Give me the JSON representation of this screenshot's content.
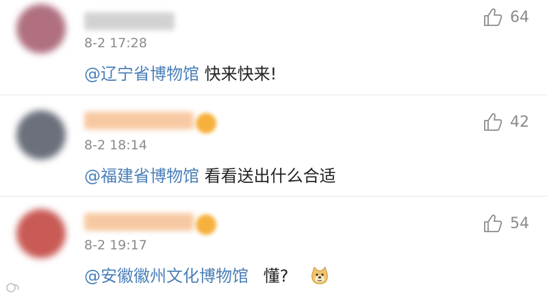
{
  "comments": [
    {
      "time": "8-2 17:28",
      "mention": "@辽宁省博物馆",
      "text": "快来快来!",
      "likes": "64",
      "avatar_color": "#b07080",
      "name_color": "#cfcfcf",
      "verified": false
    },
    {
      "time": "8-2 18:14",
      "mention": "@福建省博物馆",
      "text": "看看送出什么合适",
      "likes": "42",
      "avatar_color": "#6b707c",
      "name_color": "#f7c79a",
      "verified": true
    },
    {
      "time": "8-2 19:17",
      "mention": "@安徽徽州文化博物馆",
      "text": "懂?",
      "likes": "54",
      "avatar_color": "#c95a55",
      "name_color": "#f7c79a",
      "verified": true
    }
  ],
  "emoji": "doge-emoji",
  "watermark": {
    "icon": "logo-icon"
  },
  "colors": {
    "mention": "#4a7fb8",
    "text": "#222222",
    "meta": "#8a8a8a"
  }
}
